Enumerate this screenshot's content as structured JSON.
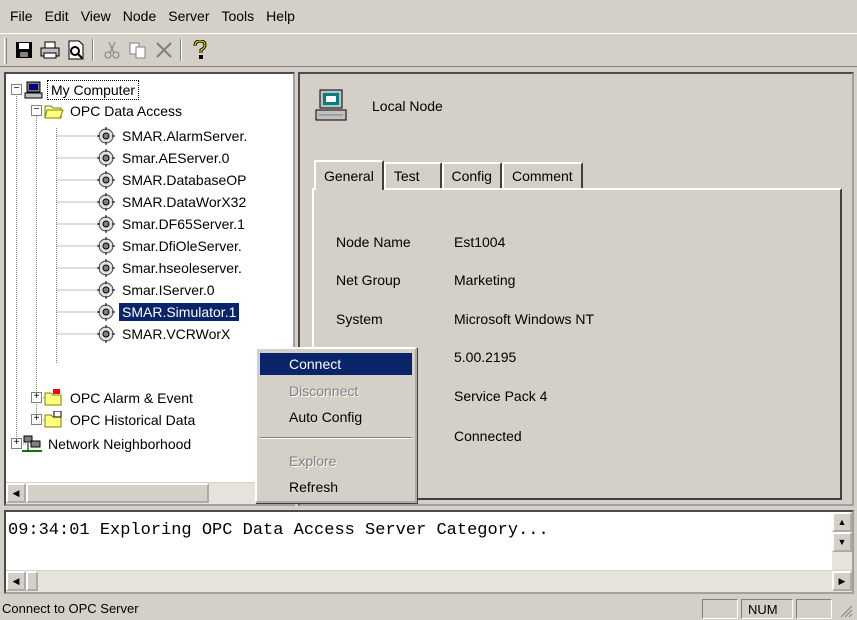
{
  "menubar": {
    "items": [
      "File",
      "Edit",
      "View",
      "Node",
      "Server",
      "Tools",
      "Help"
    ]
  },
  "toolbar": {
    "buttons": [
      "save-icon",
      "print-icon",
      "print-preview-icon",
      "cut-icon",
      "copy-icon",
      "delete-icon",
      "help-icon"
    ]
  },
  "tree": {
    "root": "My Computer",
    "opc_da": "OPC Data Access",
    "servers": [
      "SMAR.AlarmServer.",
      "Smar.AEServer.0",
      "SMAR.DatabaseOP",
      "SMAR.DataWorX32",
      "Smar.DF65Server.1",
      "Smar.DfiOleServer.",
      "Smar.hseoleserver.",
      "Smar.IServer.0",
      "SMAR.Simulator.1",
      "SMAR.VCRWorX"
    ],
    "opc_ae": "OPC Alarm & Event",
    "opc_hda": "OPC Historical Data",
    "network": "Network Neighborhood"
  },
  "detail": {
    "title": "Local Node",
    "tabs": [
      "General",
      "Test",
      "Config",
      "Comment"
    ],
    "fields": [
      {
        "label": "Node Name",
        "value": "Est1004"
      },
      {
        "label": "Net Group",
        "value": "Marketing"
      },
      {
        "label": "System",
        "value": "Microsoft Windows NT"
      },
      {
        "label": "",
        "value": "5.00.2195"
      },
      {
        "label": "",
        "value": "Service Pack 4"
      },
      {
        "label": "",
        "value": "Connected"
      }
    ]
  },
  "context_menu": {
    "connect": "Connect",
    "disconnect": "Disconnect",
    "auto_config": "Auto Config",
    "explore": "Explore",
    "refresh": "Refresh"
  },
  "log": {
    "line": "09:34:01 Exploring OPC Data Access Server Category..."
  },
  "status": {
    "text": "Connect to OPC Server",
    "num": "NUM"
  },
  "colors": {
    "face": "#d4d0c8",
    "selection": "#0a246a"
  }
}
